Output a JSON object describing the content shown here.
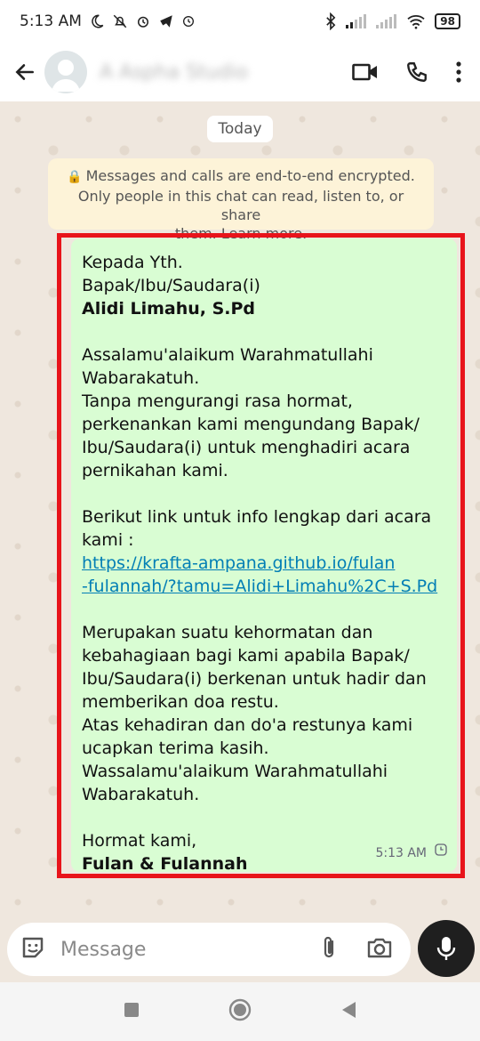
{
  "status_bar": {
    "time": "5:13 AM",
    "battery": "98"
  },
  "header": {
    "contact_name": "A Aspha Studio"
  },
  "chat": {
    "date_chip": "Today",
    "encryption_notice": [
      "Messages and calls are end-to-end encrypted.",
      "Only people in this chat can read, listen to, or share",
      "them. Learn more."
    ],
    "message": {
      "lines": [
        {
          "text": "Kepada Yth.",
          "style": "normal"
        },
        {
          "text": "Bapak/Ibu/Saudara(i)",
          "style": "normal"
        },
        {
          "text": "Alidi Limahu, S.Pd",
          "style": "bold"
        },
        {
          "text": "",
          "style": "gap"
        },
        {
          "text": "Assalamu'alaikum Warahmatullahi",
          "style": "normal"
        },
        {
          "text": "Wabarakatuh.",
          "style": "normal"
        },
        {
          "text": "Tanpa mengurangi rasa hormat,",
          "style": "normal"
        },
        {
          "text": "perkenankan kami mengundang Bapak/",
          "style": "normal"
        },
        {
          "text": "Ibu/Saudara(i) untuk menghadiri acara",
          "style": "normal"
        },
        {
          "text": "pernikahan kami.",
          "style": "normal"
        },
        {
          "text": "",
          "style": "gap"
        },
        {
          "text": "Berikut link untuk info lengkap dari acara",
          "style": "normal"
        },
        {
          "text": "kami :",
          "style": "normal"
        },
        {
          "text": "https://krafta-ampana.github.io/fulan",
          "style": "link"
        },
        {
          "text": "-fulannah/?tamu=Alidi+Limahu%2C+S.Pd",
          "style": "link"
        },
        {
          "text": "",
          "style": "gap"
        },
        {
          "text": "Merupakan suatu kehormatan dan",
          "style": "normal"
        },
        {
          "text": "kebahagiaan bagi kami apabila Bapak/",
          "style": "normal"
        },
        {
          "text": "Ibu/Saudara(i) berkenan untuk hadir dan",
          "style": "normal"
        },
        {
          "text": "memberikan doa restu.",
          "style": "normal"
        },
        {
          "text": "Atas kehadiran dan do'a restunya kami",
          "style": "normal"
        },
        {
          "text": "ucapkan terima kasih.",
          "style": "normal"
        },
        {
          "text": "Wassalamu'alaikum Warahmatullahi",
          "style": "normal"
        },
        {
          "text": "Wabarakatuh.",
          "style": "normal"
        },
        {
          "text": "",
          "style": "gap"
        },
        {
          "text": "Hormat kami,",
          "style": "normal"
        },
        {
          "text": "Fulan & Fulannah",
          "style": "bold"
        }
      ],
      "time": "5:13 AM",
      "status_icon": "clock-pending-icon"
    }
  },
  "input": {
    "placeholder": "Message"
  },
  "colors": {
    "bubble": "#d9fdd3",
    "highlight": "#e8141b",
    "link": "#027eb5",
    "notice": "#fdf3d8"
  }
}
